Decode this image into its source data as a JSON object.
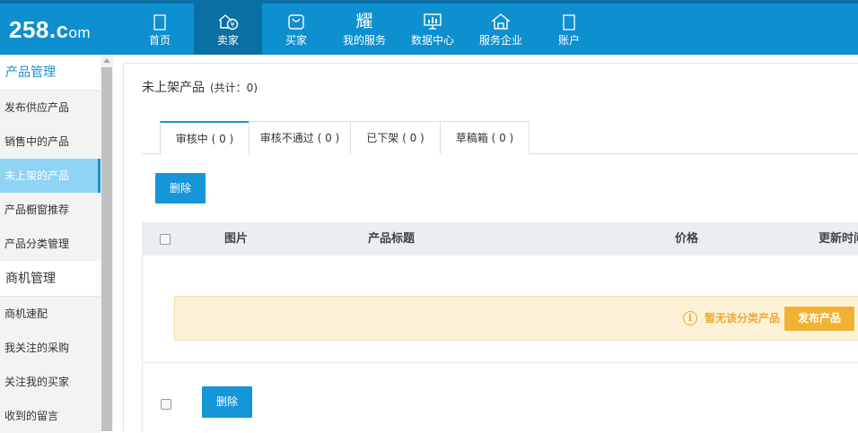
{
  "logo": {
    "main": "258.",
    "c": "c",
    "om": "om"
  },
  "nav": [
    {
      "label": "首页",
      "icon": "home-icon"
    },
    {
      "label": "卖家",
      "icon": "seller-icon"
    },
    {
      "label": "买家",
      "icon": "buyer-icon"
    },
    {
      "label": "我的服务",
      "icon": "service-icon"
    },
    {
      "label": "数据中心",
      "icon": "data-center-icon"
    },
    {
      "label": "服务企业",
      "icon": "enterprise-icon"
    },
    {
      "label": "账户",
      "icon": "account-icon"
    }
  ],
  "sidebar": {
    "section1": "产品管理",
    "items1": [
      "发布供应产品",
      "销售中的产品",
      "未上架的产品",
      "产品橱窗推荐",
      "产品分类管理"
    ],
    "section2": "商机管理",
    "items2": [
      "商机速配",
      "我关注的采购",
      "关注我的买家",
      "收到的留言"
    ]
  },
  "main": {
    "title": "未上架产品",
    "count": "(共计：0)",
    "tabs": [
      "审核中 ( 0 )",
      "审核不通过 ( 0 )",
      "已下架 ( 0 )",
      "草稿箱 ( 0 )"
    ],
    "delete_label": "删除",
    "columns": [
      "图片",
      "产品标题",
      "价格",
      "更新时间"
    ],
    "empty_text": "暂无该分类产品",
    "publish_label": "发布产品",
    "info_glyph": "i"
  },
  "colors": {
    "brand": "#0e8fcf",
    "accent": "#1496d9",
    "warning": "#f0b232"
  }
}
